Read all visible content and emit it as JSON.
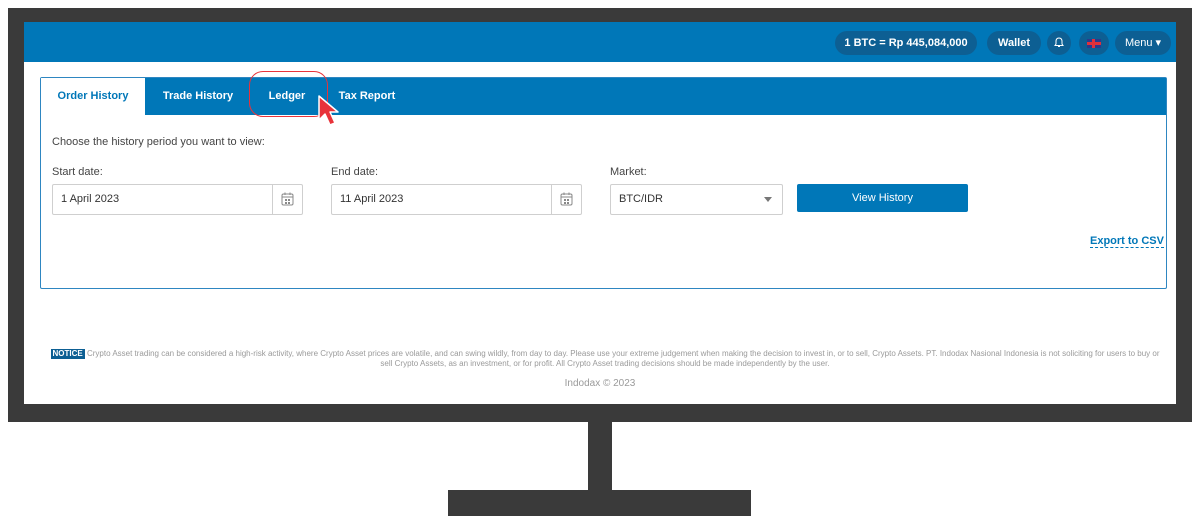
{
  "topbar": {
    "rate": "1 BTC = Rp 445,084,000",
    "wallet": "Wallet",
    "bell_icon": "bell-icon",
    "flag_icon": "uk-flag-icon",
    "menu": "Menu ▾"
  },
  "tabs": [
    {
      "label": "Order History",
      "active": true
    },
    {
      "label": "Trade History",
      "active": false
    },
    {
      "label": "Ledger",
      "active": false
    },
    {
      "label": "Tax Report",
      "active": false
    }
  ],
  "form": {
    "intro": "Choose the history period you want to view:",
    "start_label": "Start date:",
    "start_value": "1 April 2023",
    "end_label": "End date:",
    "end_value": "11 April 2023",
    "market_label": "Market:",
    "market_value": "BTC/IDR",
    "view_button": "View History",
    "export": "Export to CSV"
  },
  "footer": {
    "notice_badge": "NOTICE",
    "notice_text": "Crypto Asset trading can be considered a high-risk activity, where Crypto Asset prices are volatile, and can swing wildly, from day to day. Please use your extreme judgement when making the decision to invest in, or to sell, Crypto Assets. PT. Indodax Nasional Indonesia is not soliciting for users to buy or sell Crypto Assets, as an investment, or for profit. All Crypto Asset trading decisions should be made independently by the user.",
    "copyright": "Indodax © 2023"
  },
  "colors": {
    "primary": "#0077b8",
    "highlight": "#e8333a",
    "frame": "#3a3a3a"
  }
}
